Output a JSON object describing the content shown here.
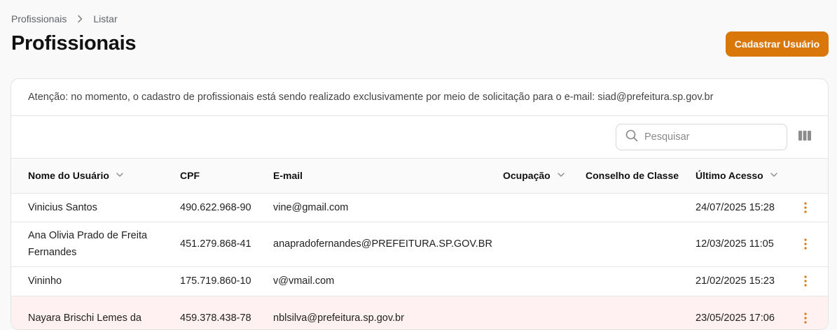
{
  "breadcrumb": {
    "items": [
      "Profissionais",
      "Listar"
    ]
  },
  "page": {
    "title": "Profissionais"
  },
  "actions": {
    "register_label": "Cadastrar Usuário"
  },
  "notice": {
    "text": "Atenção: no momento, o cadastro de profissionais está sendo realizado exclusivamente por meio de solicitação para o e-mail: siad@prefeitura.sp.gov.br"
  },
  "search": {
    "placeholder": "Pesquisar",
    "value": ""
  },
  "colors": {
    "accent": "#d9770b",
    "highlight_row": "#fff1f1"
  },
  "table": {
    "columns": [
      "Nome do Usuário",
      "CPF",
      "E-mail",
      "Ocupação",
      "Conselho de Classe",
      "Último Acesso"
    ],
    "sortable": [
      true,
      false,
      false,
      true,
      false,
      true
    ],
    "rows": [
      {
        "name": "Vinicius Santos",
        "cpf": "490.622.968-90",
        "email": "vine@gmail.com",
        "ocupacao": "",
        "conselho": "",
        "ultimo_acesso": "24/07/2025 15:28"
      },
      {
        "name": "Ana Olivia Prado de Freita Fernandes",
        "cpf": "451.279.868-41",
        "email": "anapradofernandes@PREFEITURA.SP.GOV.BR",
        "ocupacao": "",
        "conselho": "",
        "ultimo_acesso": "12/03/2025 11:05"
      },
      {
        "name": "Vininho",
        "cpf": "175.719.860-10",
        "email": "v@vmail.com",
        "ocupacao": "",
        "conselho": "",
        "ultimo_acesso": "21/02/2025 15:23"
      },
      {
        "name": "Nayara Brischi Lemes da",
        "cpf": "459.378.438-78",
        "email": "nblsilva@prefeitura.sp.gov.br",
        "ocupacao": "",
        "conselho": "",
        "ultimo_acesso": "23/05/2025 17:06"
      }
    ]
  }
}
